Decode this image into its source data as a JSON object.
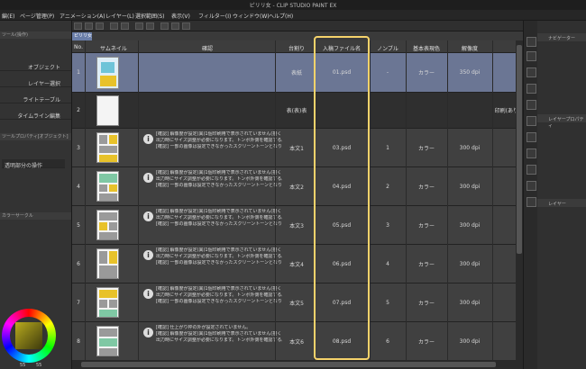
{
  "window": {
    "title": "ピリリ女 - CLIP STUDIO PAINT EX"
  },
  "menu": [
    "編(E)",
    "ページ管理(P)",
    "アニメーション(A)",
    "レイヤー(L)",
    "選択範囲(S)",
    "表示(V)",
    "フィルター(I)",
    "ウィンドウ(W)",
    "ヘルプ(H)"
  ],
  "left_panel": {
    "header": "ツール(操作)",
    "items": [
      "オブジェクト",
      "レイヤー選択",
      "ライトテーブル",
      "タイムライン編集"
    ],
    "subheader": "ツールプロパティ[オブジェクト]",
    "dropdown": "透明部分の操作",
    "color_header": "カラーサークル",
    "color_value": "55",
    "color_value2": "55"
  },
  "tab": {
    "label": "ピリリ女"
  },
  "table": {
    "headers": [
      "No.",
      "サムネイル",
      "確認",
      "台割り",
      "入稿ファイル名",
      "ノンブル",
      "基本表現色",
      "解像度"
    ],
    "rows": [
      {
        "no": "1",
        "memo": "",
        "daiwari": "表紙",
        "file": "01.psd",
        "nombre": "-",
        "color": "カラー",
        "res": "350 dpi",
        "info": false
      },
      {
        "no": "2",
        "memo": "",
        "daiwari": "表(表)表",
        "file": "",
        "nombre": "",
        "color": "",
        "res": "",
        "info": false,
        "extra": "印刷(あり)"
      },
      {
        "no": "3",
        "memo": "[確認] 解像度が設定(異)1個印刷用で表示されていません(描くと…",
        "memo2": "出力時にサイズ調整が必要になります。トンボ外側を確認する。",
        "memo3": "[確認] 一部の画像は設定できなかったスクリーントーンとなります。",
        "daiwari": "本文1",
        "file": "03.psd",
        "nombre": "1",
        "color": "カラー",
        "res": "300 dpi",
        "info": true
      },
      {
        "no": "4",
        "memo": "[確認] 解像度が設定(異)1個印刷用で表示されていません(描くと…",
        "memo2": "出力時にサイズ調整が必要になります。トンボ外側を確認する。",
        "memo3": "[確認] 一部の画像は設定できなかったスクリーントーンとなります。",
        "daiwari": "本文2",
        "file": "04.psd",
        "nombre": "2",
        "color": "カラー",
        "res": "300 dpi",
        "info": true
      },
      {
        "no": "5",
        "memo": "[確認] 解像度が設定(異)1個印刷用で表示されていません(描くと…",
        "memo2": "出力時にサイズ調整が必要になります。トンボ外側を確認する。",
        "memo3": "[確認] 一部の画像は設定できなかったスクリーントーンとなります。",
        "daiwari": "本文3",
        "file": "05.psd",
        "nombre": "3",
        "color": "カラー",
        "res": "300 dpi",
        "info": true
      },
      {
        "no": "6",
        "memo": "[確認] 解像度が設定(異)1個印刷用で表示されていません(描くと…",
        "memo2": "出力時にサイズ調整が必要になります。トンボ外側を確認する。",
        "memo3": "[確認] 一部の画像は設定できなかったスクリーントーンとなります。",
        "daiwari": "本文4",
        "file": "06.psd",
        "nombre": "4",
        "color": "カラー",
        "res": "300 dpi",
        "info": true
      },
      {
        "no": "7",
        "memo": "[確認] 解像度が設定(異)1個印刷用で表示されていません(描くと…",
        "memo2": "出力時にサイズ調整が必要になります。トンボ外側を確認する。",
        "memo3": "[確認] 一部の画像は設定できなかったスクリーントーンとなります。",
        "daiwari": "本文5",
        "file": "07.psd",
        "nombre": "5",
        "color": "カラー",
        "res": "300 dpi",
        "info": true
      },
      {
        "no": "8",
        "memo": "[確認] 仕上がり枠の外が設定されていません。",
        "memo2": "[確認] 解像度が設定(異)1個印刷用で表示されていません(描くと…",
        "memo3": "出力時にサイズ調整が必要になります。トンボ外側を確認する。",
        "daiwari": "本文6",
        "file": "08.psd",
        "nombre": "6",
        "color": "カラー",
        "res": "300 dpi",
        "info": true
      }
    ]
  },
  "right_panel": {
    "nav_label": "ナビゲーター",
    "layer_prop": "レイヤープロパティ",
    "layer_label": "レイヤー"
  }
}
